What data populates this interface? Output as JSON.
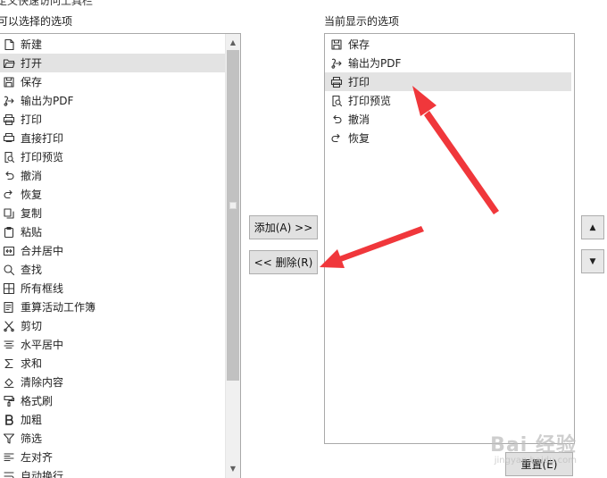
{
  "header": {
    "cut_title": "定义快速访问工具栏"
  },
  "left_pane": {
    "label": "可以选择的选项",
    "items": [
      {
        "label": "新建",
        "icon": "new-file-icon"
      },
      {
        "label": "打开",
        "icon": "open-folder-icon",
        "selected": true
      },
      {
        "label": "保存",
        "icon": "save-icon"
      },
      {
        "label": "输出为PDF",
        "icon": "export-pdf-icon"
      },
      {
        "label": "打印",
        "icon": "print-icon"
      },
      {
        "label": "直接打印",
        "icon": "quick-print-icon"
      },
      {
        "label": "打印预览",
        "icon": "print-preview-icon"
      },
      {
        "label": "撤消",
        "icon": "undo-icon"
      },
      {
        "label": "恢复",
        "icon": "redo-icon"
      },
      {
        "label": "复制",
        "icon": "copy-icon"
      },
      {
        "label": "粘贴",
        "icon": "paste-icon"
      },
      {
        "label": "合并居中",
        "icon": "merge-center-icon"
      },
      {
        "label": "查找",
        "icon": "find-icon"
      },
      {
        "label": "所有框线",
        "icon": "all-borders-icon"
      },
      {
        "label": "重算活动工作簿",
        "icon": "recalculate-icon"
      },
      {
        "label": "剪切",
        "icon": "cut-icon"
      },
      {
        "label": "水平居中",
        "icon": "align-center-icon"
      },
      {
        "label": "求和",
        "icon": "sum-icon"
      },
      {
        "label": "清除内容",
        "icon": "clear-content-icon"
      },
      {
        "label": "格式刷",
        "icon": "format-painter-icon"
      },
      {
        "label": "加粗",
        "icon": "bold-icon"
      },
      {
        "label": "筛选",
        "icon": "filter-icon"
      },
      {
        "label": "左对齐",
        "icon": "align-left-icon"
      },
      {
        "label": "自动换行",
        "icon": "wrap-text-icon"
      }
    ]
  },
  "right_pane": {
    "label": "当前显示的选项",
    "items": [
      {
        "label": "保存",
        "icon": "save-icon"
      },
      {
        "label": "输出为PDF",
        "icon": "export-pdf-icon"
      },
      {
        "label": "打印",
        "icon": "print-icon",
        "selected": true
      },
      {
        "label": "打印预览",
        "icon": "print-preview-icon"
      },
      {
        "label": "撤消",
        "icon": "undo-icon"
      },
      {
        "label": "恢复",
        "icon": "redo-icon"
      }
    ]
  },
  "buttons": {
    "add": "添加(A) >>",
    "remove": "<< 删除(R)",
    "reset": "重置(E)",
    "move_up_icon": "move-up-icon",
    "move_down_icon": "move-down-icon"
  },
  "colors": {
    "selection": "#e3e3e3",
    "annotation_arrow": "#f0373b",
    "scroll_thumb": "#c1c1c1"
  },
  "watermark": {
    "main": "Bai 经验",
    "sub": "jingyan.baidu.com"
  }
}
